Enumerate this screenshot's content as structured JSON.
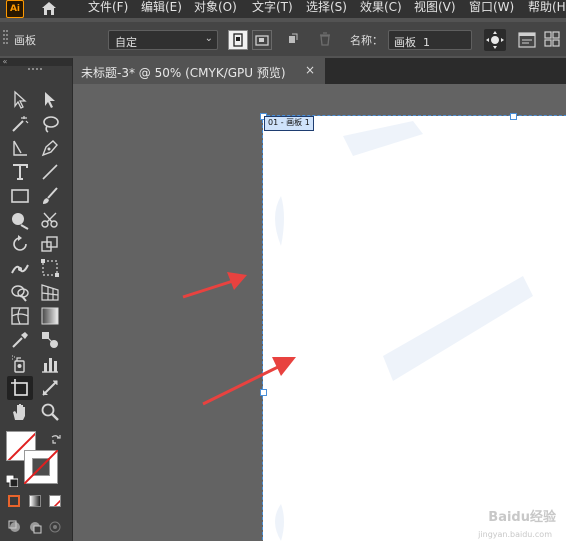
{
  "menubar": {
    "logo": "Ai",
    "items": [
      "文件(F)",
      "编辑(E)",
      "对象(O)",
      "文字(T)",
      "选择(S)",
      "效果(C)",
      "视图(V)",
      "窗口(W)",
      "帮助(H)"
    ]
  },
  "control_bar": {
    "mode_label": "画板",
    "preset_value": "自定",
    "name_label": "名称：",
    "name_value": "画板  1"
  },
  "document": {
    "tab_title": "未标题-3* @ 50% (CMYK/GPU 预览)",
    "tab_close": "×"
  },
  "artboard": {
    "label": "01 - 画板 1"
  },
  "watermark": {
    "text": "Baidu经验",
    "url": "jingyan.baidu.com"
  },
  "annotations": {
    "arrow_color": "#e8423f"
  }
}
